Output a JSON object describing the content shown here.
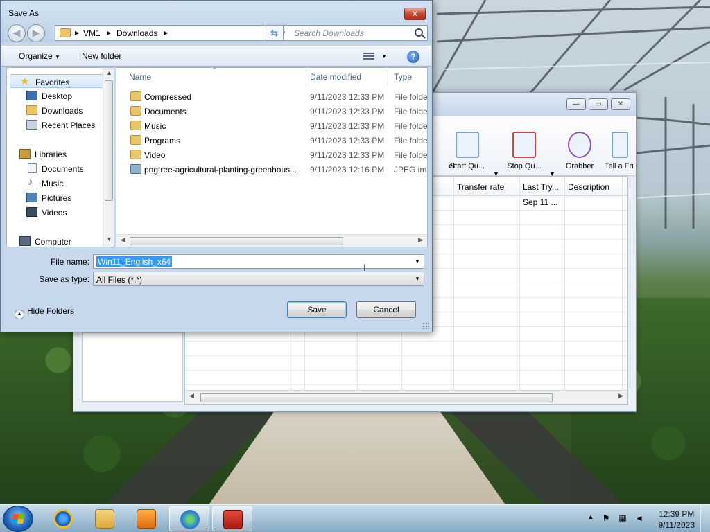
{
  "dialog": {
    "title": "Save As",
    "close_glyph": "✕",
    "nav": {
      "back_glyph": "◀",
      "forward_glyph": "▶",
      "path": [
        "VM1",
        "Downloads"
      ],
      "search_placeholder": "Search Downloads"
    },
    "toolbar": {
      "organize_label": "Organize",
      "new_folder_label": "New folder",
      "help_glyph": "?"
    },
    "sidebar": {
      "items": [
        {
          "label": "Favorites",
          "icon": "star-icon",
          "color": "#f3b51f"
        },
        {
          "label": "Desktop",
          "icon": "desktop-icon",
          "color": "#3b6fb5"
        },
        {
          "label": "Downloads",
          "icon": "downloads-icon",
          "color": "#e9c56a"
        },
        {
          "label": "Recent Places",
          "icon": "recent-places-icon",
          "color": "#8a9bb0"
        },
        {
          "label": "Libraries",
          "icon": "libraries-icon",
          "color": "#c99a3a"
        },
        {
          "label": "Documents",
          "icon": "documents-icon",
          "color": "#dfe7f2"
        },
        {
          "label": "Music",
          "icon": "music-icon",
          "color": "#2d6ab8"
        },
        {
          "label": "Pictures",
          "icon": "pictures-icon",
          "color": "#4f86b9"
        },
        {
          "label": "Videos",
          "icon": "videos-icon",
          "color": "#3b4d63"
        },
        {
          "label": "Computer",
          "icon": "computer-icon",
          "color": "#5a6c85"
        }
      ]
    },
    "columns": {
      "name": "Name",
      "date": "Date modified",
      "type": "Type"
    },
    "files": [
      {
        "name": "Compressed",
        "date": "9/11/2023 12:33 PM",
        "type": "File folder",
        "icon": "folder-icon"
      },
      {
        "name": "Documents",
        "date": "9/11/2023 12:33 PM",
        "type": "File folder",
        "icon": "folder-icon"
      },
      {
        "name": "Music",
        "date": "9/11/2023 12:33 PM",
        "type": "File folder",
        "icon": "folder-icon"
      },
      {
        "name": "Programs",
        "date": "9/11/2023 12:33 PM",
        "type": "File folder",
        "icon": "folder-icon"
      },
      {
        "name": "Video",
        "date": "9/11/2023 12:33 PM",
        "type": "File folder",
        "icon": "folder-icon"
      },
      {
        "name": "pngtree-agricultural-planting-greenhous...",
        "date": "9/11/2023 12:16 PM",
        "type": "JPEG image",
        "icon": "image-file-icon"
      }
    ],
    "file_name_label": "File name:",
    "file_name_value": "Win11_English_x64",
    "save_as_type_label": "Save as type:",
    "save_as_type_value": "All Files (*.*)",
    "hide_folders_label": "Hide Folders",
    "save_label": "Save",
    "cancel_label": "Cancel"
  },
  "background_app": {
    "toolbar_buttons": [
      {
        "label": "er",
        "icon": "partial-button-icon"
      },
      {
        "label": "Start Qu...",
        "icon": "start-queue-icon"
      },
      {
        "label": "Stop Qu...",
        "icon": "stop-queue-icon"
      },
      {
        "label": "Grabber",
        "icon": "grabber-icon"
      },
      {
        "label": "Tell a Fri",
        "icon": "tell-a-friend-icon"
      }
    ],
    "columns": [
      "Transfer rate",
      "Last Try...",
      "Description"
    ],
    "rows": [
      {
        "last_try": "Sep 11 ..."
      }
    ]
  },
  "taskbar": {
    "apps": [
      {
        "name": "internet-explorer",
        "icon": "internet-explorer-icon"
      },
      {
        "name": "file-explorer",
        "icon": "file-explorer-icon"
      },
      {
        "name": "media-player",
        "icon": "media-player-icon"
      },
      {
        "name": "download-manager",
        "icon": "download-manager-icon"
      },
      {
        "name": "toolbox-app",
        "icon": "toolbox-icon"
      }
    ],
    "time": "12:39 PM",
    "date": "9/11/2023"
  },
  "colors": {
    "selection": "#3399ff",
    "dialog_frame": "#c9d9ec",
    "close_button": "#c7482f"
  }
}
